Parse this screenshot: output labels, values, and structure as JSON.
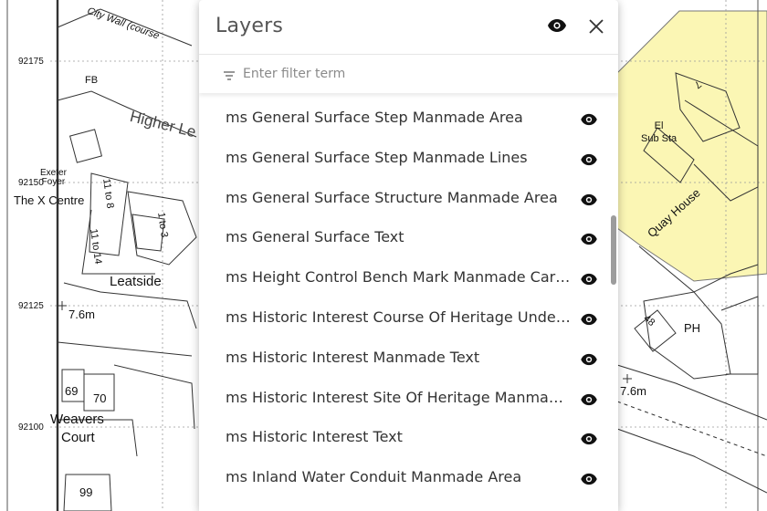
{
  "map": {
    "coords": [
      "92175",
      "92150",
      "92125",
      "92100"
    ],
    "labels": {
      "city_wall": "City Wall (course",
      "fb": "FB",
      "higher_le": "Higher Le",
      "exeter_foyer": "Exeter\nFoyer",
      "x_centre": "The X Centre",
      "n_11_to_8": "11 to 8",
      "n_1_to_3": "1 to 3",
      "n_11_to_14": "11 to 14",
      "leatside": "Leatside",
      "height_left": "7.6m",
      "n_69": "69",
      "n_70": "70",
      "weavers": "Weavers",
      "court": "Court",
      "n_99": "99",
      "el_sub_sta": "El\nSub Sta",
      "n_7": "7",
      "quay_house": "Quay House",
      "n_48": "48",
      "ph": "PH",
      "height_right": "7.6m"
    },
    "colors": {
      "highlight_fill": "#fbf6b4"
    }
  },
  "panel": {
    "title": "Layers",
    "header_icon": "eye-icon",
    "close_icon": "close-icon",
    "filter": {
      "placeholder": "Enter filter term",
      "value": "",
      "icon": "filter-lines-icon"
    },
    "layers": [
      {
        "label": "ms General Surface Step Manmade Area",
        "visible": true
      },
      {
        "label": "ms General Surface Step Manmade Lines",
        "visible": true
      },
      {
        "label": "ms General Surface Structure Manmade Area",
        "visible": true
      },
      {
        "label": "ms General Surface Text",
        "visible": true
      },
      {
        "label": "ms Height Control Bench Mark Manmade Cart…",
        "visible": true
      },
      {
        "label": "ms Historic Interest Course Of Heritage Unde…",
        "visible": true
      },
      {
        "label": "ms Historic Interest Manmade Text",
        "visible": true
      },
      {
        "label": "ms Historic Interest Site Of Heritage Manma…",
        "visible": true
      },
      {
        "label": "ms Historic Interest Text",
        "visible": true
      },
      {
        "label": "ms Inland Water Conduit Manmade Area",
        "visible": true
      }
    ]
  }
}
